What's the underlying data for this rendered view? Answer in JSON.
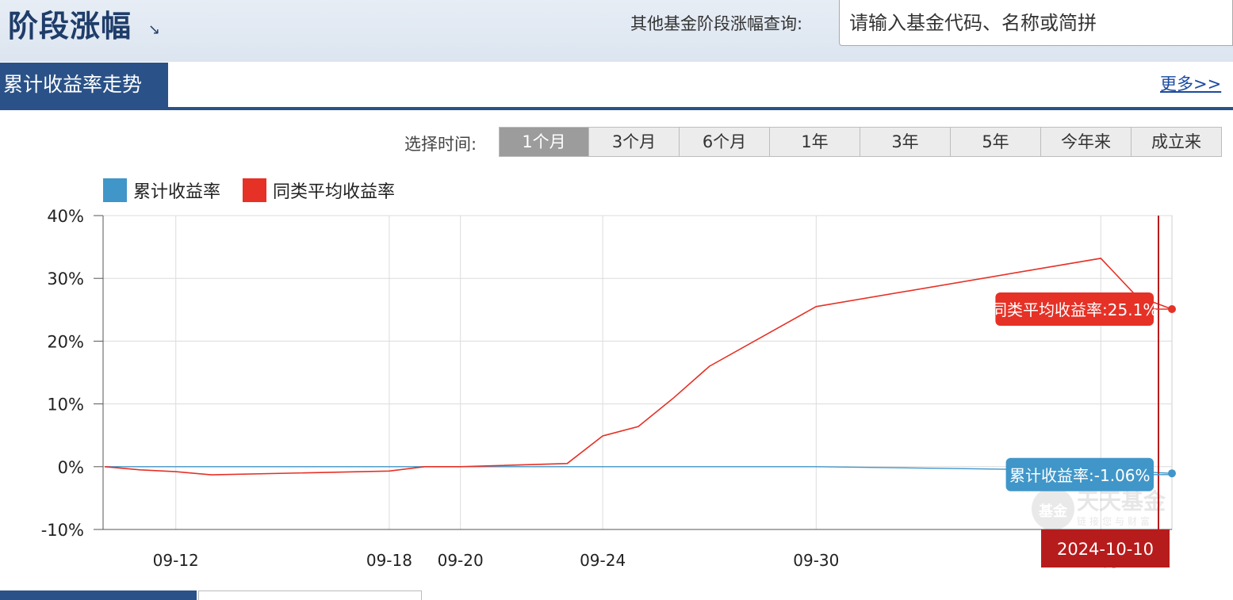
{
  "header": {
    "title": "阶段涨幅",
    "search_label": "其他基金阶段涨幅查询:",
    "search_placeholder": "请输入基金代码、名称或简拼"
  },
  "section": {
    "tab_label": "累计收益率走势",
    "more_label": "更多>>"
  },
  "range_selector": {
    "label": "选择时间:",
    "options": [
      "1个月",
      "3个月",
      "6个月",
      "1年",
      "3年",
      "5年",
      "今年来",
      "成立来"
    ],
    "active": "1个月"
  },
  "colors": {
    "fund": "#4096c8",
    "peer": "#e63126",
    "date_flag": "#b71c1c"
  },
  "chart_data": {
    "type": "line",
    "legend": [
      "累计收益率",
      "同类平均收益率"
    ],
    "ylim": [
      -10,
      40
    ],
    "yticks": [
      -10,
      0,
      10,
      20,
      30,
      40
    ],
    "ytick_labels": [
      "-10%",
      "0%",
      "10%",
      "20%",
      "30%",
      "40%"
    ],
    "x_dates": [
      "2024-09-10",
      "2024-09-11",
      "2024-09-12",
      "2024-09-13",
      "2024-09-18",
      "2024-09-19",
      "2024-09-20",
      "2024-09-23",
      "2024-09-24",
      "2024-09-25",
      "2024-09-26",
      "2024-09-27",
      "2024-09-30",
      "2024-10-08",
      "2024-10-09",
      "2024-10-10"
    ],
    "xticks": [
      {
        "date": "2024-09-12",
        "label": "09-12",
        "bold": false
      },
      {
        "date": "2024-09-18",
        "label": "09-18",
        "bold": false
      },
      {
        "date": "2024-09-20",
        "label": "09-20",
        "bold": false
      },
      {
        "date": "2024-09-24",
        "label": "09-24",
        "bold": false
      },
      {
        "date": "2024-09-30",
        "label": "09-30",
        "bold": false
      },
      {
        "date": "2024-10-08",
        "label": "10月",
        "bold": true
      }
    ],
    "series": [
      {
        "name": "累计收益率",
        "values": [
          0,
          0,
          0,
          0,
          0,
          0,
          0,
          0,
          0,
          0,
          0,
          0,
          0,
          -0.6,
          -0.8,
          -1.06
        ]
      },
      {
        "name": "同类平均收益率",
        "values": [
          0,
          -0.5,
          -0.8,
          -1.3,
          -0.7,
          0,
          0,
          0.5,
          4.9,
          6.4,
          11.0,
          16.0,
          25.5,
          33.2,
          27.2,
          25.1
        ]
      }
    ],
    "tooltip": {
      "date": "2024-10-10",
      "peer_label": "同类平均收益率:25.1%",
      "fund_label": "累计收益率:-1.06%"
    },
    "watermark": {
      "main": "天天基金",
      "sub": "链接您与财富",
      "badge": "基金"
    }
  }
}
